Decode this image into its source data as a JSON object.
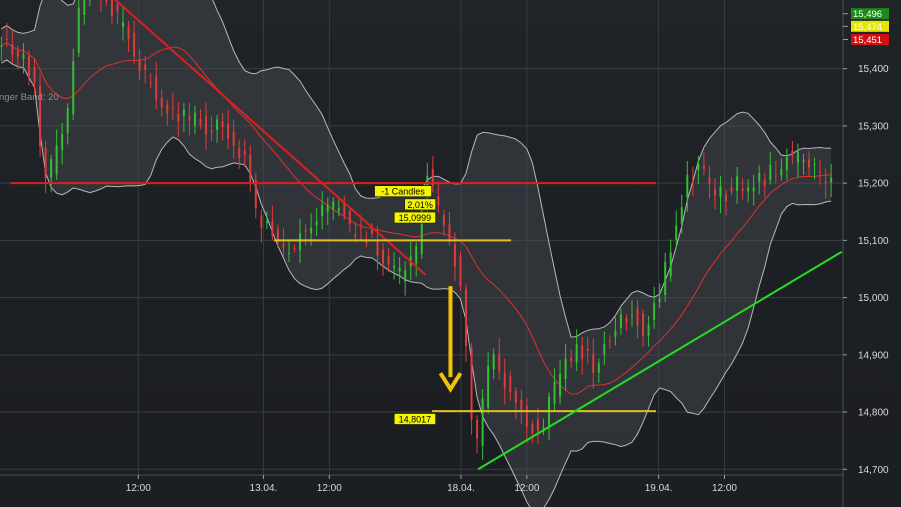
{
  "chart_data": {
    "type": "candlestick",
    "indicator_label": "nger Band: 20",
    "y_axis": {
      "ticks": [
        14.7,
        14.8,
        14.9,
        15.0,
        15.1,
        15.2,
        15.3,
        15.4
      ],
      "tick_labels": [
        "14,700",
        "14,800",
        "14,900",
        "15,000",
        "15,100",
        "15,200",
        "15,300",
        "15,400"
      ],
      "range": [
        14.69,
        15.52
      ]
    },
    "x_axis": {
      "labels": [
        {
          "t": 10.5,
          "label": "12:00"
        },
        {
          "t": 20.0,
          "label": "13.04."
        },
        {
          "t": 25.0,
          "label": "12:00"
        },
        {
          "t": 35.0,
          "label": "18.04."
        },
        {
          "t": 40.0,
          "label": "12:00"
        },
        {
          "t": 50.0,
          "label": "19.04."
        },
        {
          "t": 55.0,
          "label": "12:00"
        }
      ],
      "range": [
        0,
        64
      ]
    },
    "price_tags": [
      {
        "value": 15.496,
        "label": "15,496",
        "color": "#1a8c1a"
      },
      {
        "value": 15.474,
        "label": "15,474",
        "color": "#e5e500"
      },
      {
        "value": 15.451,
        "label": "15,451",
        "color": "#d01010"
      }
    ],
    "price_path": [
      [
        0,
        15.45
      ],
      [
        1,
        15.44
      ],
      [
        2,
        15.42
      ],
      [
        3,
        15.38
      ],
      [
        3.7,
        15.2
      ],
      [
        4.5,
        15.24
      ],
      [
        5.5,
        15.31
      ],
      [
        6.3,
        15.49
      ],
      [
        7,
        15.55
      ],
      [
        8,
        15.52
      ],
      [
        9,
        15.5
      ],
      [
        10,
        15.46
      ],
      [
        11,
        15.4
      ],
      [
        12,
        15.37
      ],
      [
        13,
        15.33
      ],
      [
        14,
        15.32
      ],
      [
        15,
        15.31
      ],
      [
        16,
        15.3
      ],
      [
        17,
        15.3
      ],
      [
        18,
        15.28
      ],
      [
        19,
        15.24
      ],
      [
        20,
        15.14
      ],
      [
        21,
        15.11
      ],
      [
        22,
        15.08
      ],
      [
        23,
        15.1
      ],
      [
        24,
        15.13
      ],
      [
        25,
        15.15
      ],
      [
        26,
        15.16
      ],
      [
        27,
        15.12
      ],
      [
        28,
        15.11
      ],
      [
        29,
        15.09
      ],
      [
        30,
        15.05
      ],
      [
        31,
        15.04
      ],
      [
        32,
        15.08
      ],
      [
        32.7,
        15.22
      ],
      [
        33.5,
        15.17
      ],
      [
        34.5,
        15.1
      ],
      [
        35.2,
        15.05
      ],
      [
        36,
        14.86
      ],
      [
        36.4,
        14.72
      ],
      [
        37,
        14.8
      ],
      [
        37.8,
        14.92
      ],
      [
        38.5,
        14.86
      ],
      [
        39.5,
        14.82
      ],
      [
        40.5,
        14.78
      ],
      [
        41.5,
        14.77
      ],
      [
        42.5,
        14.84
      ],
      [
        43.5,
        14.89
      ],
      [
        44.5,
        14.91
      ],
      [
        45.5,
        14.88
      ],
      [
        46.5,
        14.92
      ],
      [
        47.5,
        14.96
      ],
      [
        48.5,
        14.97
      ],
      [
        49.5,
        14.94
      ],
      [
        50.5,
        15.01
      ],
      [
        51.5,
        15.1
      ],
      [
        52.5,
        15.2
      ],
      [
        53.5,
        15.23
      ],
      [
        54.5,
        15.19
      ],
      [
        55.5,
        15.18
      ],
      [
        56.5,
        15.2
      ],
      [
        57.5,
        15.2
      ],
      [
        58.5,
        15.21
      ],
      [
        59.5,
        15.23
      ],
      [
        60.5,
        15.25
      ],
      [
        61.5,
        15.24
      ],
      [
        62.5,
        15.22
      ],
      [
        63.3,
        15.2
      ]
    ],
    "annotations": [
      {
        "type": "hline",
        "value": 15.2,
        "t_start": 0.8,
        "t_end": 49.8,
        "color": "#dd1f1f"
      },
      {
        "type": "trendline",
        "points": [
          [
            7.3,
            15.55
          ],
          [
            32.3,
            15.04
          ]
        ],
        "color": "#dd1f1f"
      },
      {
        "type": "hline",
        "value": 15.0999,
        "t_start": 20.8,
        "t_end": 38.8,
        "color": "#e0c020"
      },
      {
        "type": "hline",
        "value": 14.8017,
        "t_start": 32.8,
        "t_end": 49.8,
        "color": "#e0c020"
      },
      {
        "type": "trendline",
        "points": [
          [
            36.3,
            14.7
          ],
          [
            63.9,
            15.08
          ]
        ],
        "color": "#22dd22"
      },
      {
        "type": "arrow",
        "t": 34.2,
        "from": 15.02,
        "to": 14.84,
        "color": "#f2c400"
      }
    ],
    "labels": [
      {
        "text": "-1 Candles",
        "t": 30.6,
        "value": 15.185
      },
      {
        "text": "2,01%",
        "t": 31.9,
        "value": 15.162
      },
      {
        "text": "15,0999",
        "t": 31.5,
        "value": 15.139
      },
      {
        "text": "14,8017",
        "t": 31.5,
        "value": 14.787
      }
    ]
  }
}
